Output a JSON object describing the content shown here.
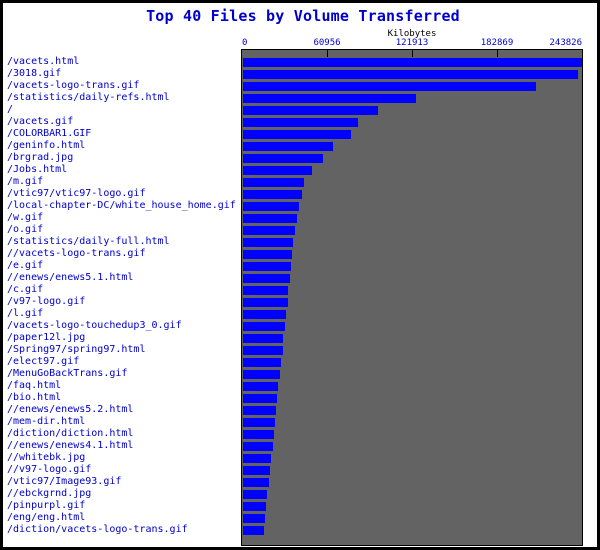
{
  "chart_data": {
    "type": "bar",
    "orientation": "horizontal",
    "title": "Top 40 Files by Volume Transferred",
    "xlabel": "Kilobytes",
    "ylabel": "",
    "xlim": [
      0,
      243826
    ],
    "xticks": [
      0,
      60956,
      121913,
      182869,
      243826
    ],
    "xtick_labels": [
      "0",
      "60956",
      "121913",
      "182869",
      "243826"
    ],
    "grid": false,
    "legend": null,
    "colors": {
      "bar": "#0000ff",
      "plot_background": "#636363",
      "page_background": "#ffffff",
      "text": "#0000cc",
      "title": "#0000cc",
      "axis_title": "#000000",
      "frame": "#000000"
    },
    "categories": [
      "/vacets.html",
      "/3018.gif",
      "/vacets-logo-trans.gif",
      "/statistics/daily-refs.html",
      "/",
      "/vacets.gif",
      "/COLORBAR1.GIF",
      "/geninfo.html",
      "/brgrad.jpg",
      "/Jobs.html",
      "/m.gif",
      "/vtic97/vtic97-logo.gif",
      "/local-chapter-DC/white_house_home.gif",
      "/w.gif",
      "/o.gif",
      "/statistics/daily-full.html",
      "//vacets-logo-trans.gif",
      "/e.gif",
      "//enews/enews5.1.html",
      "/c.gif",
      "/v97-logo.gif",
      "/l.gif",
      "/vacets-logo-touchedup3_0.gif",
      "/paper12l.jpg",
      "/Spring97/spring97.html",
      "/elect97.gif",
      "/MenuGoBackTrans.gif",
      "/faq.html",
      "/bio.html",
      "//enews/enews5.2.html",
      "/mem-dir.html",
      "/diction/diction.html",
      "//enews/enews4.1.html",
      "//whitebk.jpg",
      "//v97-logo.gif",
      "/vtic97/Image93.gif",
      "//ebckgrnd.jpg",
      "/pinpurpl.gif",
      "/eng/eng.html",
      "/diction/vacets-logo-trans.gif"
    ],
    "values": [
      243826,
      240261,
      210190,
      124050,
      96763,
      82504,
      77514,
      64520,
      57392,
      49550,
      43848,
      42423,
      40285,
      38860,
      37434,
      36009,
      35296,
      34584,
      33871,
      32446,
      32446,
      31021,
      30308,
      28883,
      28883,
      27458,
      26745,
      25320,
      24607,
      23894,
      23182,
      22469,
      21756,
      20331,
      19618,
      18905,
      17480,
      16767,
      16055,
      15342
    ]
  }
}
